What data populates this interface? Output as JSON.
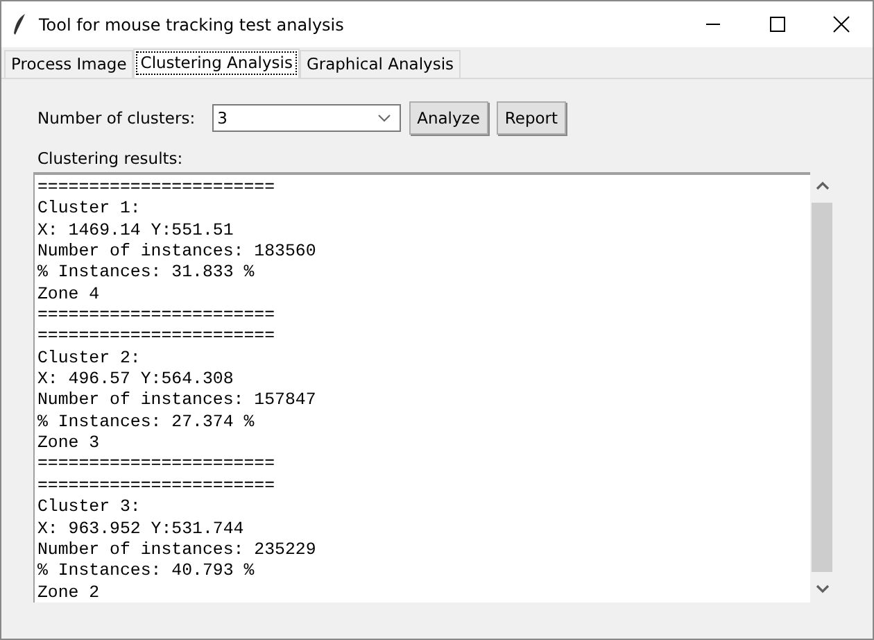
{
  "window": {
    "title": "Tool for mouse tracking test analysis"
  },
  "tabs": [
    {
      "label": "Process Image",
      "selected": false
    },
    {
      "label": "Clustering Analysis",
      "selected": true
    },
    {
      "label": "Graphical Analysis",
      "selected": false
    }
  ],
  "clusters_label": "Number of clusters:",
  "clusters_combo": {
    "value": "3"
  },
  "buttons": [
    "Analyze",
    "Report"
  ],
  "results_label": "Clustering results:",
  "results": [
    "=======================",
    "Cluster 1:",
    "X: 1469.14 Y:551.51",
    "Number of instances: 183560",
    "% Instances: 31.833 %",
    "Zone 4",
    "=======================",
    "=======================",
    "Cluster 2:",
    "X: 496.57 Y:564.308",
    "Number of instances: 157847",
    "% Instances: 27.374 %",
    "Zone 3",
    "=======================",
    "=======================",
    "Cluster 3:",
    "X: 963.952 Y:531.744",
    "Number of instances: 235229",
    "% Instances: 40.793 %",
    "Zone 2"
  ]
}
